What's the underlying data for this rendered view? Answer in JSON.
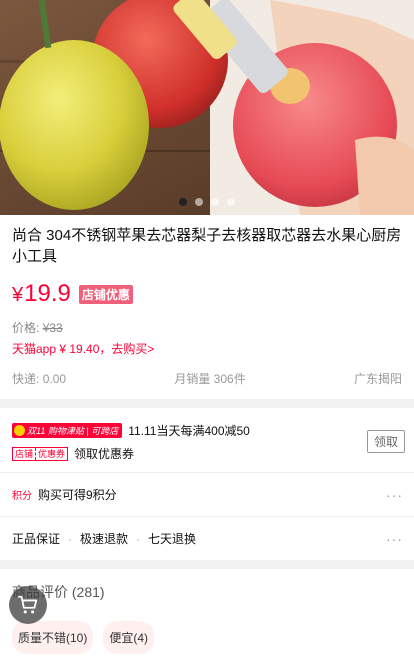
{
  "carousel": {
    "slide_count": 4,
    "active_index": 0
  },
  "product": {
    "title": "尚合 304不锈钢苹果去芯器梨子去核器取芯器去水果心厨房小工具",
    "price_symbol": "¥",
    "price": "19.9",
    "shop_tag": "店铺优惠",
    "original_price_label": "价格:",
    "original_price": "¥33",
    "app_price": "天猫app ¥ 19.40，去购买>",
    "shipping_label": "快递:",
    "shipping_value": "0.00",
    "monthly_sales_label": "月销量",
    "monthly_sales_value": "306件",
    "location": "广东揭阳"
  },
  "promotions": {
    "event_badge_left": "双11",
    "event_badge_mid": "购物津贴",
    "event_badge_right": "可跨店",
    "event_text": "11.11当天每满400减50",
    "coupon_badge_left": "店铺",
    "coupon_badge_right": "优惠券",
    "coupon_text": "领取优惠券",
    "claim_button": "领取"
  },
  "points": {
    "tag": "积分",
    "text": "购买可得9积分",
    "more": "···"
  },
  "guarantees": {
    "items": [
      "正品保证",
      "极速退款",
      "七天退换"
    ],
    "separator": "·",
    "more": "···"
  },
  "reviews": {
    "title": "商品评价",
    "count": "(281)",
    "tags": [
      "质量不错(10)",
      "便宜(4)"
    ]
  },
  "colors": {
    "accent": "#ff0036",
    "shop_tag_bg": "#f0607a",
    "tag_bg": "#fff0f0"
  },
  "icons": {
    "cart": "shopping-cart-icon"
  }
}
